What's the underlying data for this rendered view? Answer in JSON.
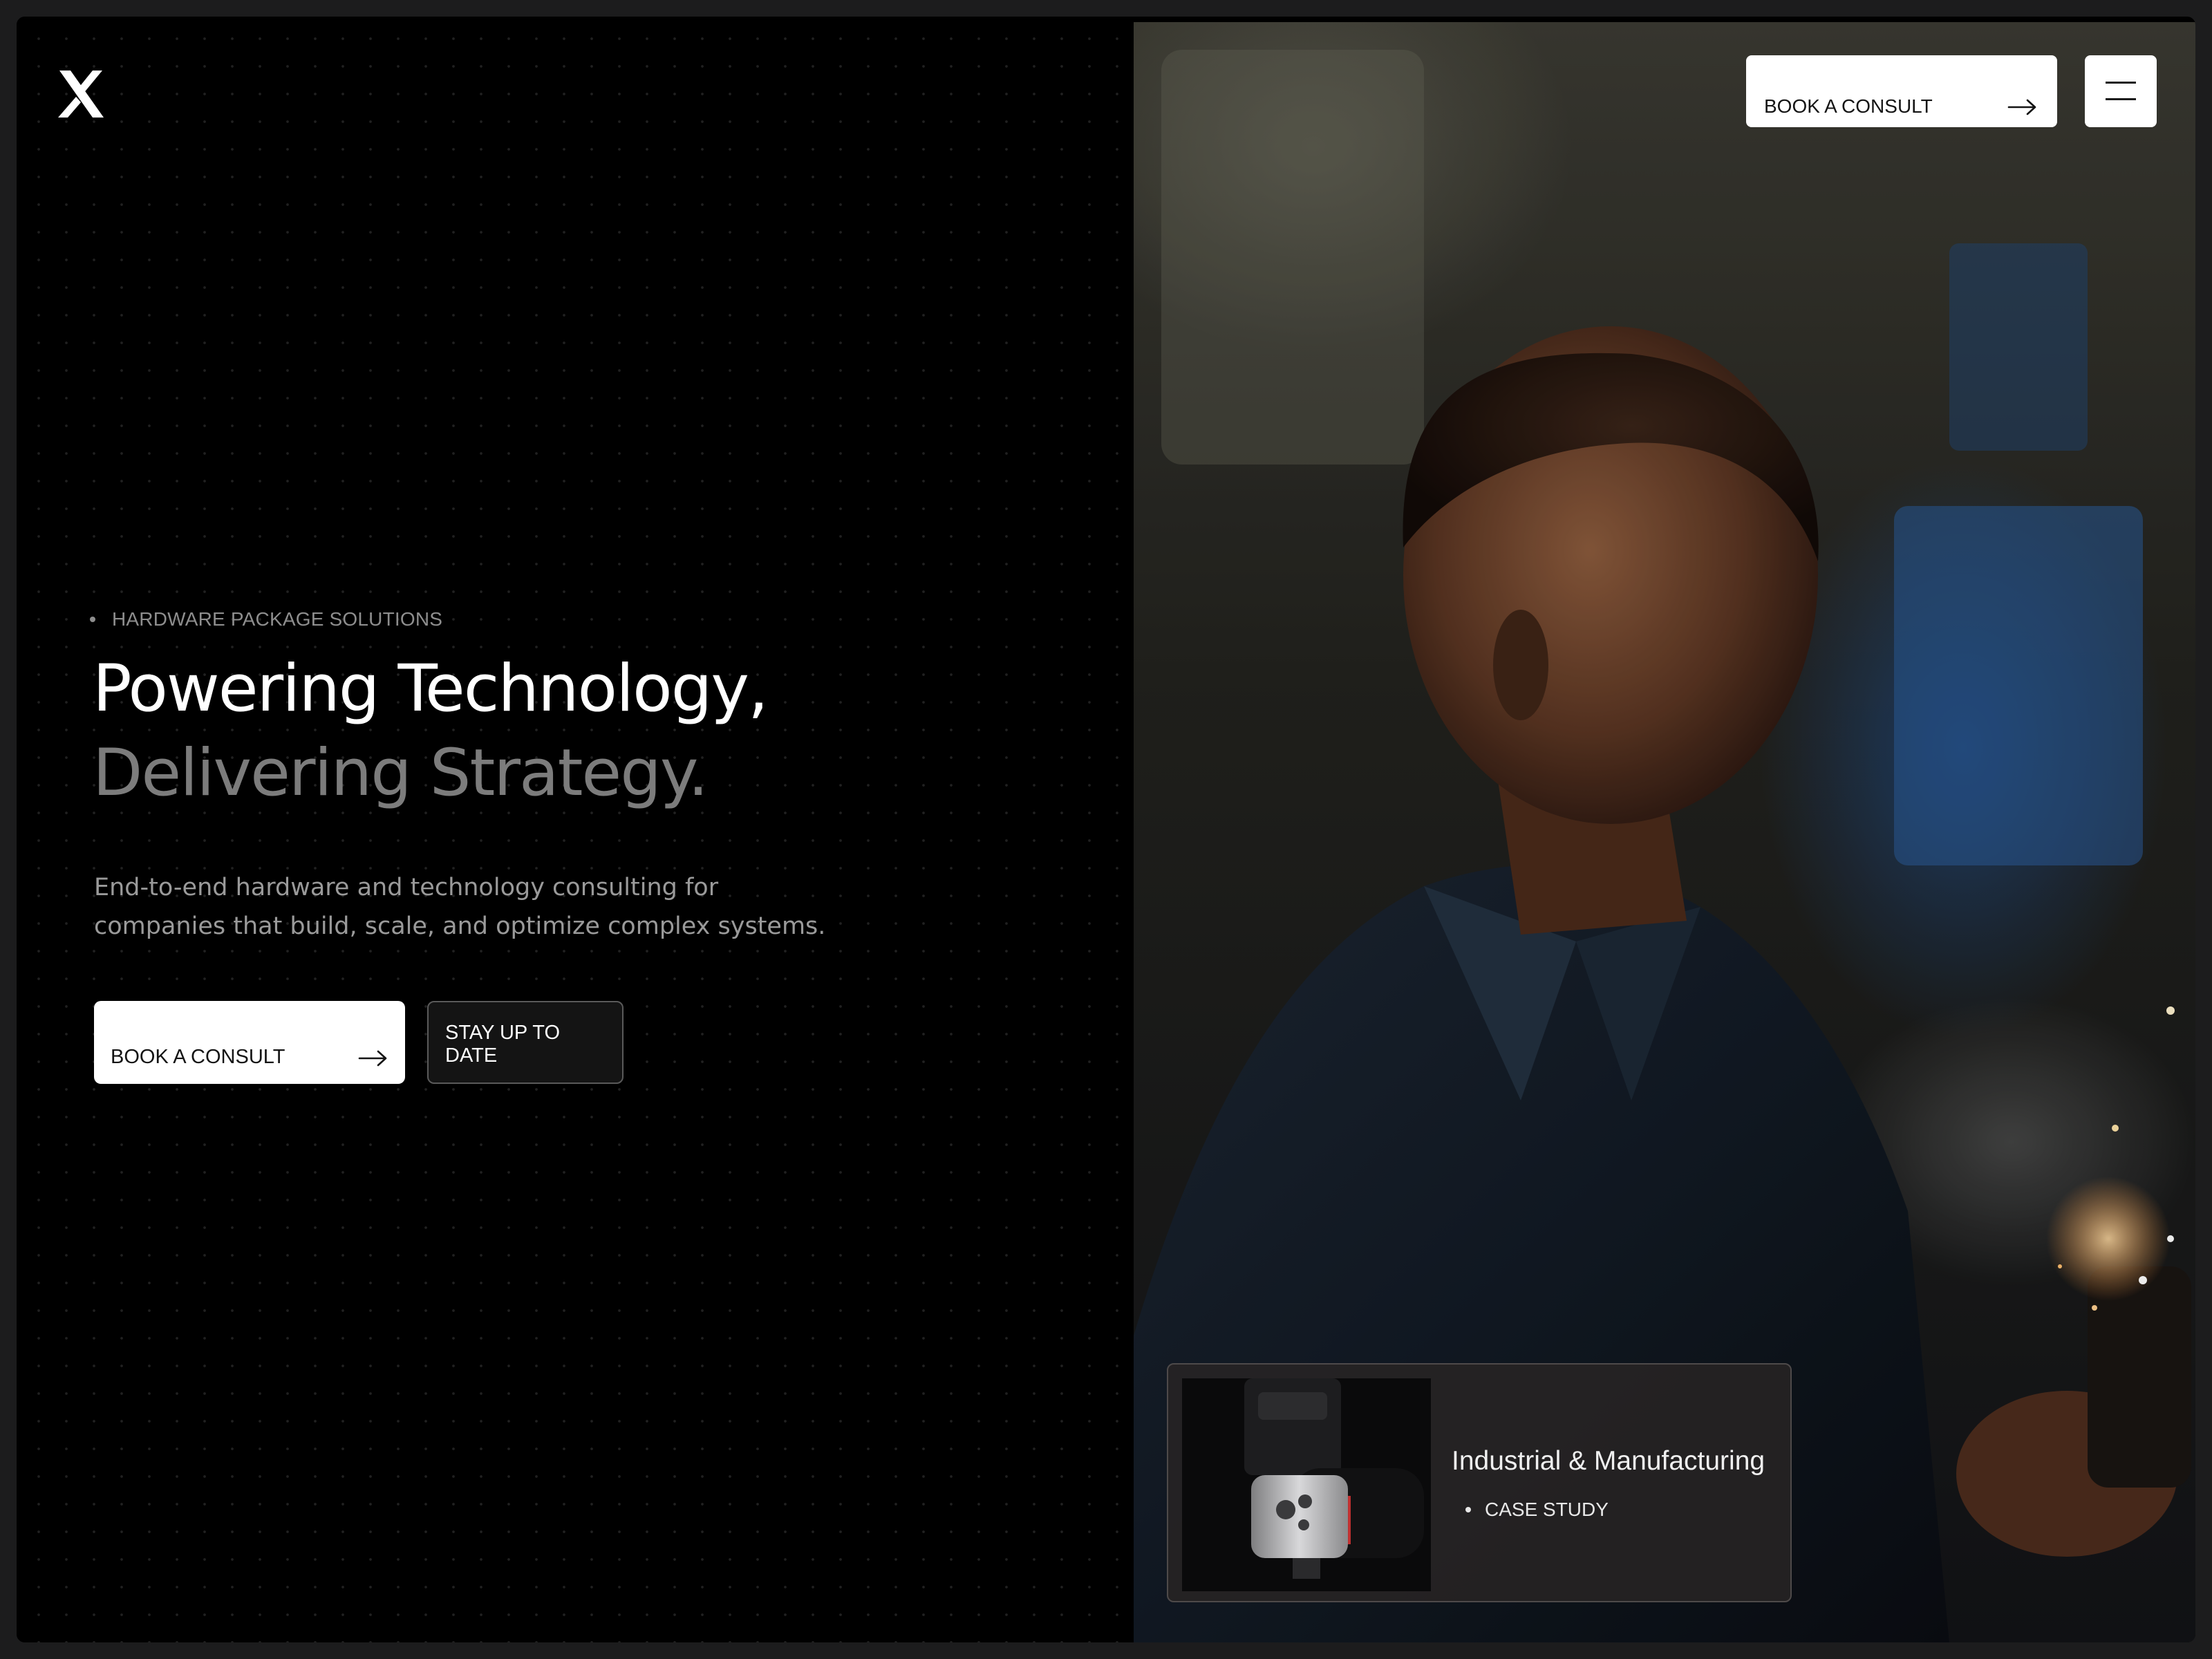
{
  "brand": {
    "logo_icon": "x-logo-icon"
  },
  "header": {
    "cta_label": "BOOK A CONSULT",
    "cta_icon": "arrow-right-icon",
    "menu_icon": "hamburger-menu-icon"
  },
  "hero": {
    "eyebrow": "HARDWARE PACKAGE SOLUTIONS",
    "headline_line1": "Powering Technology,",
    "headline_line2": "Delivering Strategy.",
    "subcopy": "End-to-end hardware and technology consulting for companies that build, scale, and optimize complex systems.",
    "primary_cta": "BOOK A CONSULT",
    "secondary_cta": "STAY UP TO DATE"
  },
  "case_card": {
    "title": "Industrial & Manufacturing",
    "tag": "CASE STUDY"
  },
  "colors": {
    "background": "#000000",
    "headline_primary": "#ffffff",
    "headline_secondary": "#7c7c7c",
    "button_light": "#ffffff",
    "button_dark": "#141414"
  }
}
